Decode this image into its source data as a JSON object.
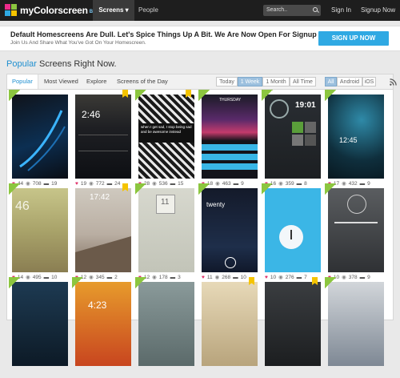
{
  "nav": {
    "logo_text": "myColorscreen",
    "logo_beta": "BETA",
    "screens": "Screens ▾",
    "people": "People",
    "search_placeholder": "Search..",
    "sign_in": "Sign In",
    "sign_up": "Signup Now"
  },
  "promo": {
    "title": "Default Homescreens Are Dull. Let's Spice Things Up A Bit. We Are Now Open For Signup",
    "subtitle": "Join Us And Share What You've Got On Your Homescreen.",
    "button": "SIGN UP NOW"
  },
  "heading": {
    "accent": "Popular",
    "rest": " Screens Right Now."
  },
  "tabs": [
    "Popular",
    "Most Viewed",
    "Explore",
    "Screens of the Day"
  ],
  "time_filters": [
    "Today",
    "1 Week",
    "1 Month",
    "All Time"
  ],
  "platform_filters": [
    "All",
    "Android",
    "iOS"
  ],
  "screens": [
    {
      "likes": "44",
      "views": "708",
      "comments": "19",
      "thumb_text": ""
    },
    {
      "likes": "19",
      "views": "772",
      "comments": "24",
      "thumb_text": "2:46"
    },
    {
      "likes": "28",
      "views": "536",
      "comments": "15",
      "thumb_text": "when I get sad, I stop being sad and be awesome instead"
    },
    {
      "likes": "18",
      "views": "463",
      "comments": "9",
      "thumb_text": "THURSDAY"
    },
    {
      "likes": "16",
      "views": "359",
      "comments": "8",
      "thumb_text": "19:01"
    },
    {
      "likes": "17",
      "views": "432",
      "comments": "9",
      "thumb_text": "12:45"
    },
    {
      "likes": "14",
      "views": "495",
      "comments": "10",
      "thumb_text": "46"
    },
    {
      "likes": "12",
      "views": "345",
      "comments": "2",
      "thumb_text": "17:42"
    },
    {
      "likes": "12",
      "views": "178",
      "comments": "3",
      "thumb_text": "11"
    },
    {
      "likes": "11",
      "views": "268",
      "comments": "10",
      "thumb_text": "twenty"
    },
    {
      "likes": "10",
      "views": "276",
      "comments": "7",
      "thumb_text": ""
    },
    {
      "likes": "10",
      "views": "378",
      "comments": "9",
      "thumb_text": ""
    },
    {
      "likes": "",
      "views": "",
      "comments": "",
      "thumb_text": ""
    },
    {
      "likes": "",
      "views": "",
      "comments": "",
      "thumb_text": "4:23"
    },
    {
      "likes": "",
      "views": "",
      "comments": "",
      "thumb_text": ""
    },
    {
      "likes": "",
      "views": "",
      "comments": "",
      "thumb_text": ""
    },
    {
      "likes": "",
      "views": "",
      "comments": "",
      "thumb_text": ""
    },
    {
      "likes": "",
      "views": "",
      "comments": "",
      "thumb_text": ""
    }
  ],
  "colors": {
    "accent": "#1f8fd0",
    "signup_button": "#2fa9e3",
    "heart": "#e0316a",
    "ribbon": "#8cc63f",
    "bookmark": "#f5c400"
  }
}
